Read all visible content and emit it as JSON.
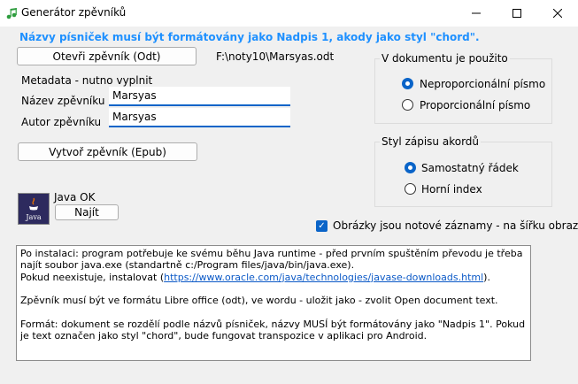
{
  "window": {
    "title": "Generátor zpěvníků"
  },
  "hint": "Názvy písniček musí být formátovány jako Nadpis 1, akody jako styl \"chord\".",
  "open_button_label": "Otevři zpěvník (Odt)",
  "file_path": "F:\\noty10\\Marsyas.odt",
  "metadata": {
    "heading": "Metadata - nutno vyplnit",
    "name_label": "Název zpěvníku",
    "name_value": "Marsyas",
    "author_label": "Autor zpěvníku",
    "author_value": "Marsyas"
  },
  "create_button_label": "Vytvoř zpěvník (Epub)",
  "java": {
    "status": "Java OK",
    "find_button_label": "Najít",
    "logo_text": "Java"
  },
  "font_group": {
    "title": "V dokumentu je použito",
    "options": [
      "Neproporcionální písmo",
      "Proporcionální písmo"
    ],
    "selected": 0
  },
  "chord_group": {
    "title": "Styl zápisu akordů",
    "options": [
      "Samostatný řádek",
      "Horní index"
    ],
    "selected": 0
  },
  "images_checkbox": {
    "label": "Obrázky jsou notové záznamy - na šířku obrazovky",
    "checked": true
  },
  "info": {
    "line1": "Po instalaci: program potřebuje ke svému běhu Java runtime - před prvním spuštěním převodu je třeba najít soubor java.exe (standartně c:/Program files/java/bin/java.exe).",
    "line2_prefix": "Pokud neexistuje, instalovat (",
    "line2_link": "https://www.oracle.com/java/technologies/javase-downloads.html",
    "line2_suffix": ").",
    "line3": "Zpěvník musí být ve formátu Libre office (odt), ve wordu - uložit jako - zvolit Open document text.",
    "line4": "Formát: dokument se rozdělí podle názvů písniček, názvy MUSÍ být formátovány jako \"Nadpis 1\". Pokud je text označen jako styl \"chord\", bude fungovat transpozice v aplikaci pro Android."
  },
  "colors": {
    "hint": "#1e90ff",
    "accent": "#0a64c8",
    "link": "#0b59c7"
  }
}
